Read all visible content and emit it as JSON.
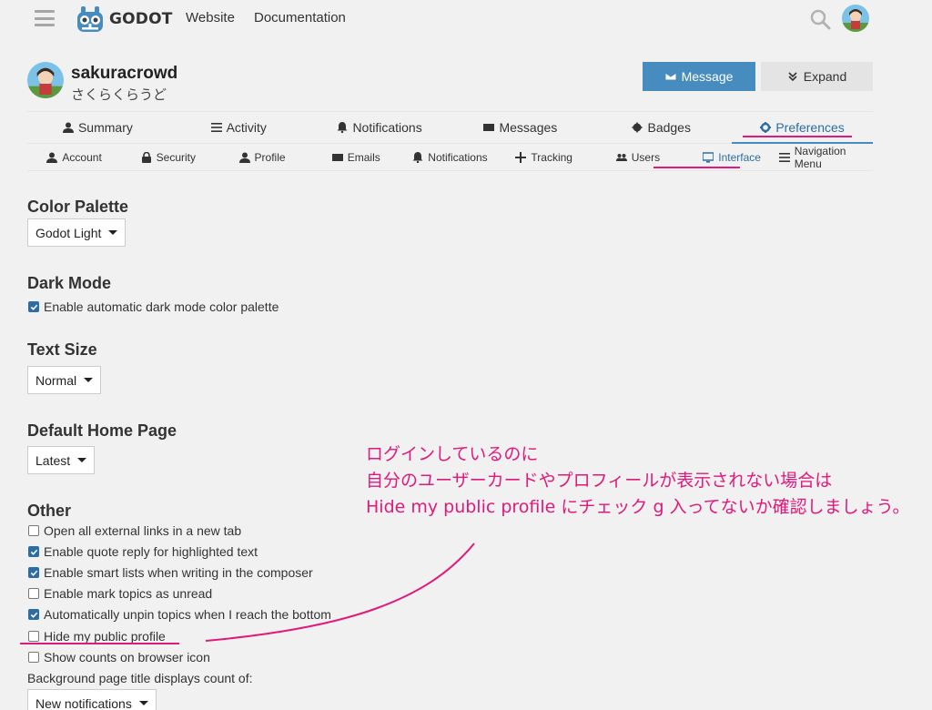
{
  "header": {
    "logo_text": "GODOT",
    "nav": [
      "Website",
      "Documentation"
    ]
  },
  "profile": {
    "username": "sakuracrowd",
    "fullname": "さくらくらうど",
    "message_label": "Message",
    "expand_label": "Expand"
  },
  "main_tabs": [
    {
      "label": "Summary",
      "icon": "user-icon"
    },
    {
      "label": "Activity",
      "icon": "list-icon"
    },
    {
      "label": "Notifications",
      "icon": "bell-icon"
    },
    {
      "label": "Messages",
      "icon": "envelope-icon"
    },
    {
      "label": "Badges",
      "icon": "badge-icon"
    },
    {
      "label": "Preferences",
      "icon": "gear-icon",
      "active": true
    }
  ],
  "sub_tabs": [
    {
      "label": "Account",
      "icon": "user-icon"
    },
    {
      "label": "Security",
      "icon": "lock-icon"
    },
    {
      "label": "Profile",
      "icon": "user-icon"
    },
    {
      "label": "Emails",
      "icon": "envelope-icon"
    },
    {
      "label": "Notifications",
      "icon": "bell-icon"
    },
    {
      "label": "Tracking",
      "icon": "plus-icon"
    },
    {
      "label": "Users",
      "icon": "users-icon"
    },
    {
      "label": "Interface",
      "icon": "desktop-icon",
      "active": true
    },
    {
      "label": "Navigation Menu",
      "icon": "list-icon"
    }
  ],
  "sections": {
    "color_palette": {
      "title": "Color Palette",
      "value": "Godot Light"
    },
    "dark_mode": {
      "title": "Dark Mode",
      "option": "Enable automatic dark mode color palette",
      "checked": true
    },
    "text_size": {
      "title": "Text Size",
      "value": "Normal"
    },
    "home_page": {
      "title": "Default Home Page",
      "value": "Latest"
    },
    "other": {
      "title": "Other",
      "options": [
        {
          "label": "Open all external links in a new tab",
          "checked": false
        },
        {
          "label": "Enable quote reply for highlighted text",
          "checked": true
        },
        {
          "label": "Enable smart lists when writing in the composer",
          "checked": true
        },
        {
          "label": "Enable mark topics as unread",
          "checked": false
        },
        {
          "label": "Automatically unpin topics when I reach the bottom",
          "checked": true
        },
        {
          "label": "Hide my public profile",
          "checked": false
        },
        {
          "label": "Show counts on browser icon",
          "checked": false
        }
      ],
      "title_count_label": "Background page title displays count of:",
      "title_count_value": "New notifications"
    }
  },
  "annotation": {
    "lines": [
      "ログインしているのに",
      "自分のユーザーカードやプロフィールが表示されない場合は",
      "Hide my public profile にチェック g 入ってないか確認しましょう。"
    ],
    "color": "#e0197a"
  },
  "colors": {
    "accent": "#478cbf",
    "active_text": "#2c6ea3"
  }
}
